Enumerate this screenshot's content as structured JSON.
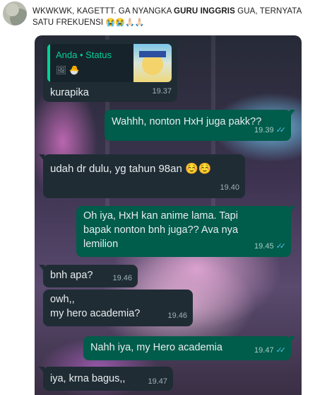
{
  "post": {
    "text_normal_1": "WKWKWK, KAGETTT. GA NYANGKA ",
    "text_bold": "GURU INGGRIS",
    "text_normal_2": " GUA, TERNYATA SATU FREKUENSI ",
    "emoji": "😭😭🙏🏻🙏🏻"
  },
  "chat": {
    "messages": [
      {
        "dir": "in",
        "text": "kurapika",
        "time": "19.37",
        "quote": {
          "sender": "Anda • Status",
          "icons": "🖼 🐣"
        }
      },
      {
        "dir": "out",
        "text": "Wahhh, nonton HxH juga pakk??",
        "time": "19.39",
        "read": "✓✓"
      },
      {
        "dir": "in",
        "text": "udah dr dulu, yg tahun 98an ☺️☺️",
        "time": "19.40"
      },
      {
        "dir": "out",
        "text_line1": "Oh iya, HxH kan anime lama. Tapi",
        "text_line2": "bapak nonton bnh juga?? Ava nya",
        "text_line3": "lemilion",
        "time": "19.45",
        "read": "✓✓"
      },
      {
        "dir": "in",
        "text": "bnh apa?",
        "time": "19.46"
      },
      {
        "dir": "in",
        "text_line1": "owh,,",
        "text_line2": "my hero academia?",
        "time": "19.46"
      },
      {
        "dir": "out",
        "text": "Nahh iya, my Hero academia",
        "time": "19.47",
        "read": "✓✓"
      },
      {
        "dir": "in",
        "text": "iya, krna bagus,,",
        "time": "19.47"
      }
    ]
  }
}
